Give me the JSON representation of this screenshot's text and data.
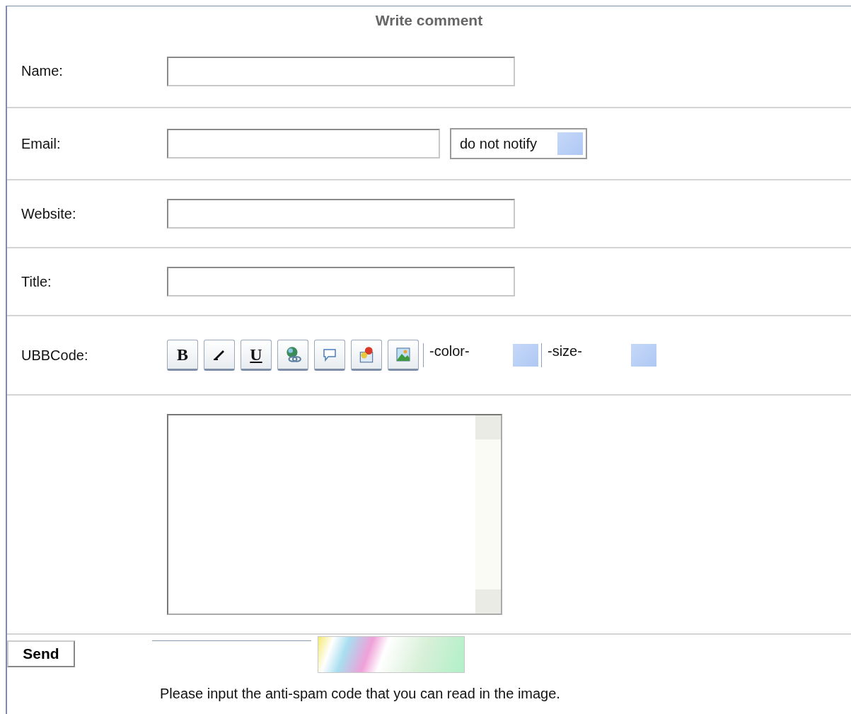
{
  "title": "Write comment",
  "rows": [
    {
      "kind": "text",
      "label": "Name:"
    },
    {
      "kind": "email",
      "label": "Email:",
      "notify": "do not notify"
    },
    {
      "kind": "text",
      "label": "Website:"
    },
    {
      "kind": "text",
      "label": "Title:"
    },
    {
      "kind": "toolbar",
      "label": "UBBCode:",
      "tools": [
        {
          "kind": "bold",
          "glyph": "B"
        },
        {
          "kind": "italic"
        },
        {
          "kind": "underline",
          "glyph": "U"
        },
        {
          "kind": "link"
        },
        {
          "kind": "quote"
        },
        {
          "kind": "email"
        },
        {
          "kind": "image"
        }
      ],
      "color_select": "-color-",
      "size_select": "-size-"
    },
    {
      "kind": "textarea"
    }
  ],
  "send": "Send",
  "hint": "Please input the anti-spam code that you can read in the image."
}
